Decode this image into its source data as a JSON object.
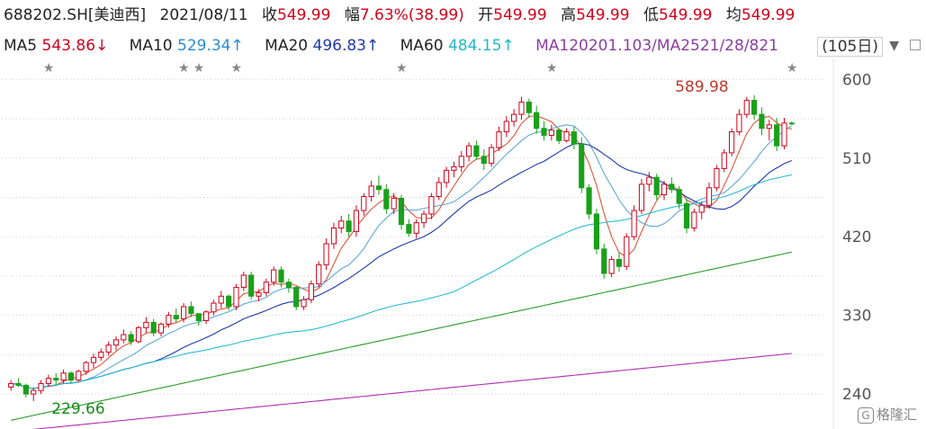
{
  "quote": {
    "code": "688202.SH[美迪西]",
    "date": "2021/08/11",
    "close_label": "收",
    "close": "549.99",
    "change_label": "幅",
    "change": "7.63%(38.99)",
    "open_label": "开",
    "open": "549.99",
    "high_label": "高",
    "high": "549.99",
    "low_label": "低",
    "low": "549.99",
    "avg_label": "均",
    "avg": "549.99"
  },
  "ma": {
    "ma5_label": "MA5",
    "ma5": "543.86↓",
    "ma10_label": "MA10",
    "ma10": "529.34↑",
    "ma20_label": "MA20",
    "ma20": "496.83↑",
    "ma60_label": "MA60",
    "ma60": "484.15↑",
    "overlap": "MA120201.103/MA2521/28/821"
  },
  "period": "(105日)",
  "logo": "格隆汇",
  "colors": {
    "up": "#d0021b",
    "down": "#1aa01a",
    "ma5": "#e0563b",
    "ma10": "#5fa8d8",
    "ma20": "#1f3aa8",
    "ma60": "#2bbcd0",
    "ma120": "#2b9a2b",
    "ma250": "#b12db1"
  },
  "chart_data": {
    "type": "candlestick",
    "ylim": [
      200,
      625
    ],
    "yticks": [
      600,
      510,
      420,
      330,
      240
    ],
    "annotations": {
      "max_label": "589.98",
      "min_label": "229.66"
    },
    "candles": [
      [
        248,
        256,
        244,
        252
      ],
      [
        252,
        258,
        248,
        250
      ],
      [
        250,
        252,
        236,
        240
      ],
      [
        240,
        247,
        232,
        244
      ],
      [
        244,
        256,
        240,
        252
      ],
      [
        252,
        262,
        248,
        258
      ],
      [
        258,
        264,
        250,
        256
      ],
      [
        256,
        268,
        252,
        264
      ],
      [
        264,
        266,
        252,
        256
      ],
      [
        256,
        268,
        254,
        266
      ],
      [
        266,
        278,
        262,
        276
      ],
      [
        276,
        286,
        270,
        282
      ],
      [
        282,
        292,
        278,
        288
      ],
      [
        288,
        300,
        284,
        296
      ],
      [
        296,
        306,
        290,
        302
      ],
      [
        302,
        314,
        298,
        308
      ],
      [
        308,
        312,
        296,
        300
      ],
      [
        300,
        318,
        298,
        316
      ],
      [
        316,
        328,
        310,
        322
      ],
      [
        322,
        326,
        306,
        310
      ],
      [
        310,
        322,
        306,
        320
      ],
      [
        320,
        334,
        316,
        330
      ],
      [
        330,
        338,
        322,
        326
      ],
      [
        326,
        344,
        322,
        340
      ],
      [
        340,
        346,
        328,
        332
      ],
      [
        332,
        330,
        318,
        324
      ],
      [
        324,
        336,
        320,
        334
      ],
      [
        334,
        348,
        330,
        344
      ],
      [
        344,
        358,
        338,
        352
      ],
      [
        352,
        354,
        336,
        340
      ],
      [
        340,
        366,
        336,
        362
      ],
      [
        362,
        380,
        358,
        376
      ],
      [
        376,
        380,
        348,
        352
      ],
      [
        352,
        360,
        346,
        356
      ],
      [
        356,
        372,
        352,
        368
      ],
      [
        368,
        386,
        364,
        382
      ],
      [
        382,
        386,
        362,
        368
      ],
      [
        368,
        372,
        356,
        362
      ],
      [
        362,
        364,
        336,
        340
      ],
      [
        340,
        352,
        336,
        348
      ],
      [
        348,
        370,
        344,
        366
      ],
      [
        366,
        392,
        362,
        388
      ],
      [
        388,
        418,
        382,
        412
      ],
      [
        412,
        436,
        406,
        430
      ],
      [
        430,
        444,
        424,
        438
      ],
      [
        438,
        446,
        420,
        426
      ],
      [
        426,
        456,
        420,
        450
      ],
      [
        450,
        470,
        444,
        466
      ],
      [
        466,
        484,
        460,
        478
      ],
      [
        478,
        490,
        468,
        474
      ],
      [
        474,
        480,
        446,
        452
      ],
      [
        452,
        470,
        446,
        464
      ],
      [
        464,
        468,
        428,
        434
      ],
      [
        434,
        440,
        420,
        424
      ],
      [
        424,
        440,
        418,
        436
      ],
      [
        436,
        450,
        430,
        446
      ],
      [
        446,
        470,
        440,
        466
      ],
      [
        466,
        488,
        462,
        482
      ],
      [
        482,
        500,
        476,
        496
      ],
      [
        496,
        506,
        488,
        500
      ],
      [
        500,
        518,
        494,
        512
      ],
      [
        512,
        528,
        506,
        524
      ],
      [
        524,
        530,
        508,
        512
      ],
      [
        512,
        520,
        496,
        504
      ],
      [
        504,
        526,
        500,
        522
      ],
      [
        522,
        546,
        518,
        540
      ],
      [
        540,
        558,
        534,
        552
      ],
      [
        552,
        566,
        546,
        560
      ],
      [
        560,
        580,
        554,
        574
      ],
      [
        574,
        578,
        556,
        562
      ],
      [
        562,
        570,
        538,
        544
      ],
      [
        544,
        552,
        530,
        536
      ],
      [
        536,
        548,
        530,
        542
      ],
      [
        542,
        544,
        526,
        530
      ],
      [
        530,
        544,
        528,
        540
      ],
      [
        540,
        546,
        520,
        526
      ],
      [
        526,
        534,
        470,
        476
      ],
      [
        476,
        480,
        440,
        446
      ],
      [
        446,
        452,
        400,
        406
      ],
      [
        406,
        412,
        372,
        378
      ],
      [
        378,
        398,
        374,
        394
      ],
      [
        394,
        402,
        380,
        386
      ],
      [
        386,
        424,
        382,
        420
      ],
      [
        420,
        456,
        416,
        450
      ],
      [
        450,
        486,
        446,
        480
      ],
      [
        480,
        494,
        472,
        488
      ],
      [
        488,
        492,
        462,
        468
      ],
      [
        468,
        484,
        462,
        480
      ],
      [
        480,
        488,
        470,
        474
      ],
      [
        474,
        478,
        452,
        458
      ],
      [
        458,
        464,
        424,
        430
      ],
      [
        430,
        452,
        426,
        448
      ],
      [
        448,
        460,
        440,
        456
      ],
      [
        456,
        482,
        452,
        476
      ],
      [
        476,
        502,
        472,
        498
      ],
      [
        498,
        520,
        494,
        516
      ],
      [
        516,
        544,
        512,
        540
      ],
      [
        540,
        566,
        536,
        560
      ],
      [
        560,
        580,
        556,
        576
      ],
      [
        576,
        582,
        554,
        560
      ],
      [
        560,
        568,
        536,
        544
      ],
      [
        544,
        554,
        530,
        548
      ],
      [
        548,
        556,
        518,
        524
      ],
      [
        524,
        556,
        520,
        550
      ],
      [
        550,
        552,
        548,
        549.99
      ]
    ]
  }
}
